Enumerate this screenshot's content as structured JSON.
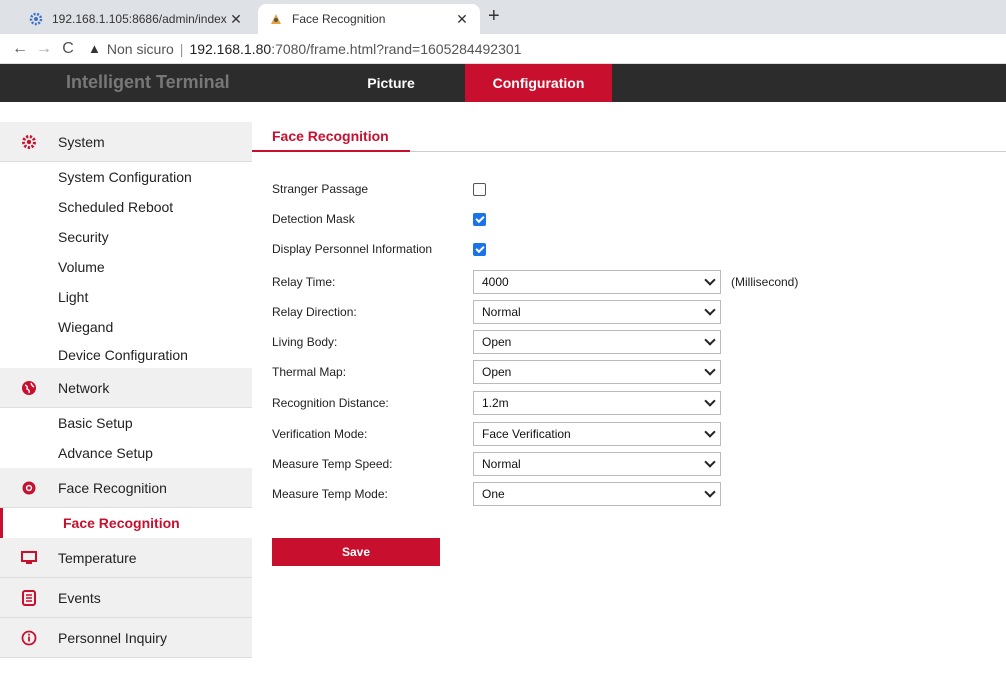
{
  "browser": {
    "tabs": [
      {
        "title": "192.168.1.105:8686/admin/index"
      },
      {
        "title": "Face Recognition"
      }
    ],
    "url_warning": "Non sicuro",
    "url_host": "192.168.1.80",
    "url_rest": ":7080/frame.html?rand=1605284492301"
  },
  "header": {
    "title": "Intelligent Terminal",
    "nav": [
      "Picture",
      "Configuration"
    ],
    "active_nav": "Configuration"
  },
  "sidebar": {
    "system": {
      "label": "System",
      "items": [
        "System Configuration",
        "Scheduled Reboot",
        "Security",
        "Volume",
        "Light",
        "Wiegand",
        "Device Configuration"
      ]
    },
    "network": {
      "label": "Network",
      "items": [
        "Basic Setup",
        "Advance Setup"
      ]
    },
    "face": {
      "label": "Face Recognition",
      "items": [
        "Face Recognition"
      ]
    },
    "temperature": {
      "label": "Temperature"
    },
    "events": {
      "label": "Events"
    },
    "personnel": {
      "label": "Personnel Inquiry"
    },
    "accent_color": "#c8102e"
  },
  "main": {
    "tab": "Face Recognition",
    "checkboxes": [
      {
        "label": "Stranger Passage",
        "checked": false
      },
      {
        "label": "Detection Mask",
        "checked": true
      },
      {
        "label": "Display Personnel Information",
        "checked": true
      }
    ],
    "selects": [
      {
        "label": "Relay Time:",
        "value": "4000",
        "unit": "(Millisecond)"
      },
      {
        "label": "Relay Direction:",
        "value": "Normal"
      },
      {
        "label": "Living Body:",
        "value": "Open"
      },
      {
        "label": "Thermal Map:",
        "value": "Open"
      },
      {
        "label": "Recognition Distance:",
        "value": "1.2m"
      },
      {
        "label": "Verification Mode:",
        "value": "Face Verification"
      },
      {
        "label": "Measure Temp Speed:",
        "value": "Normal"
      },
      {
        "label": "Measure Temp Mode:",
        "value": "One"
      }
    ],
    "save_label": "Save"
  }
}
